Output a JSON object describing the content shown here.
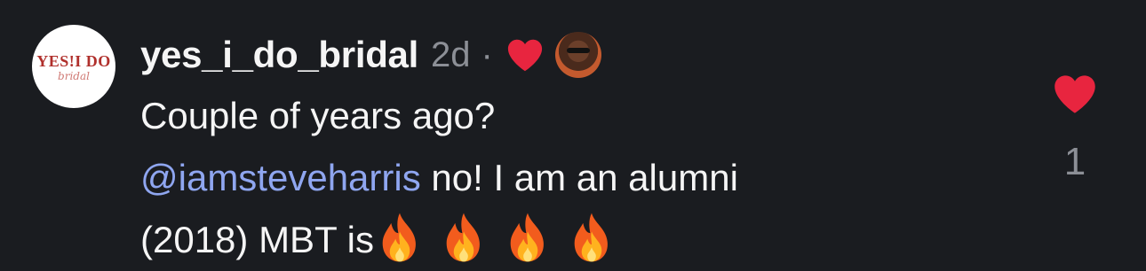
{
  "avatar": {
    "logo_text": "YES!I DO",
    "logo_sub": "bridal"
  },
  "comment": {
    "username": "yes_i_do_bridal",
    "time": "2d",
    "separator": "·",
    "line1": "Couple of years ago?",
    "mention": "@iamsteveharris",
    "line2_rest": " no! I am an alumni",
    "line3": "(2018) MBT is"
  },
  "likes": {
    "count": "1"
  },
  "colors": {
    "background": "#1a1c20",
    "heart": "#e8253f",
    "mention": "#8fa6f0",
    "muted": "#8c8f96"
  },
  "icons": {
    "creator_liked": "heart-icon",
    "like": "heart-icon",
    "emoji": "fire-emoji"
  }
}
